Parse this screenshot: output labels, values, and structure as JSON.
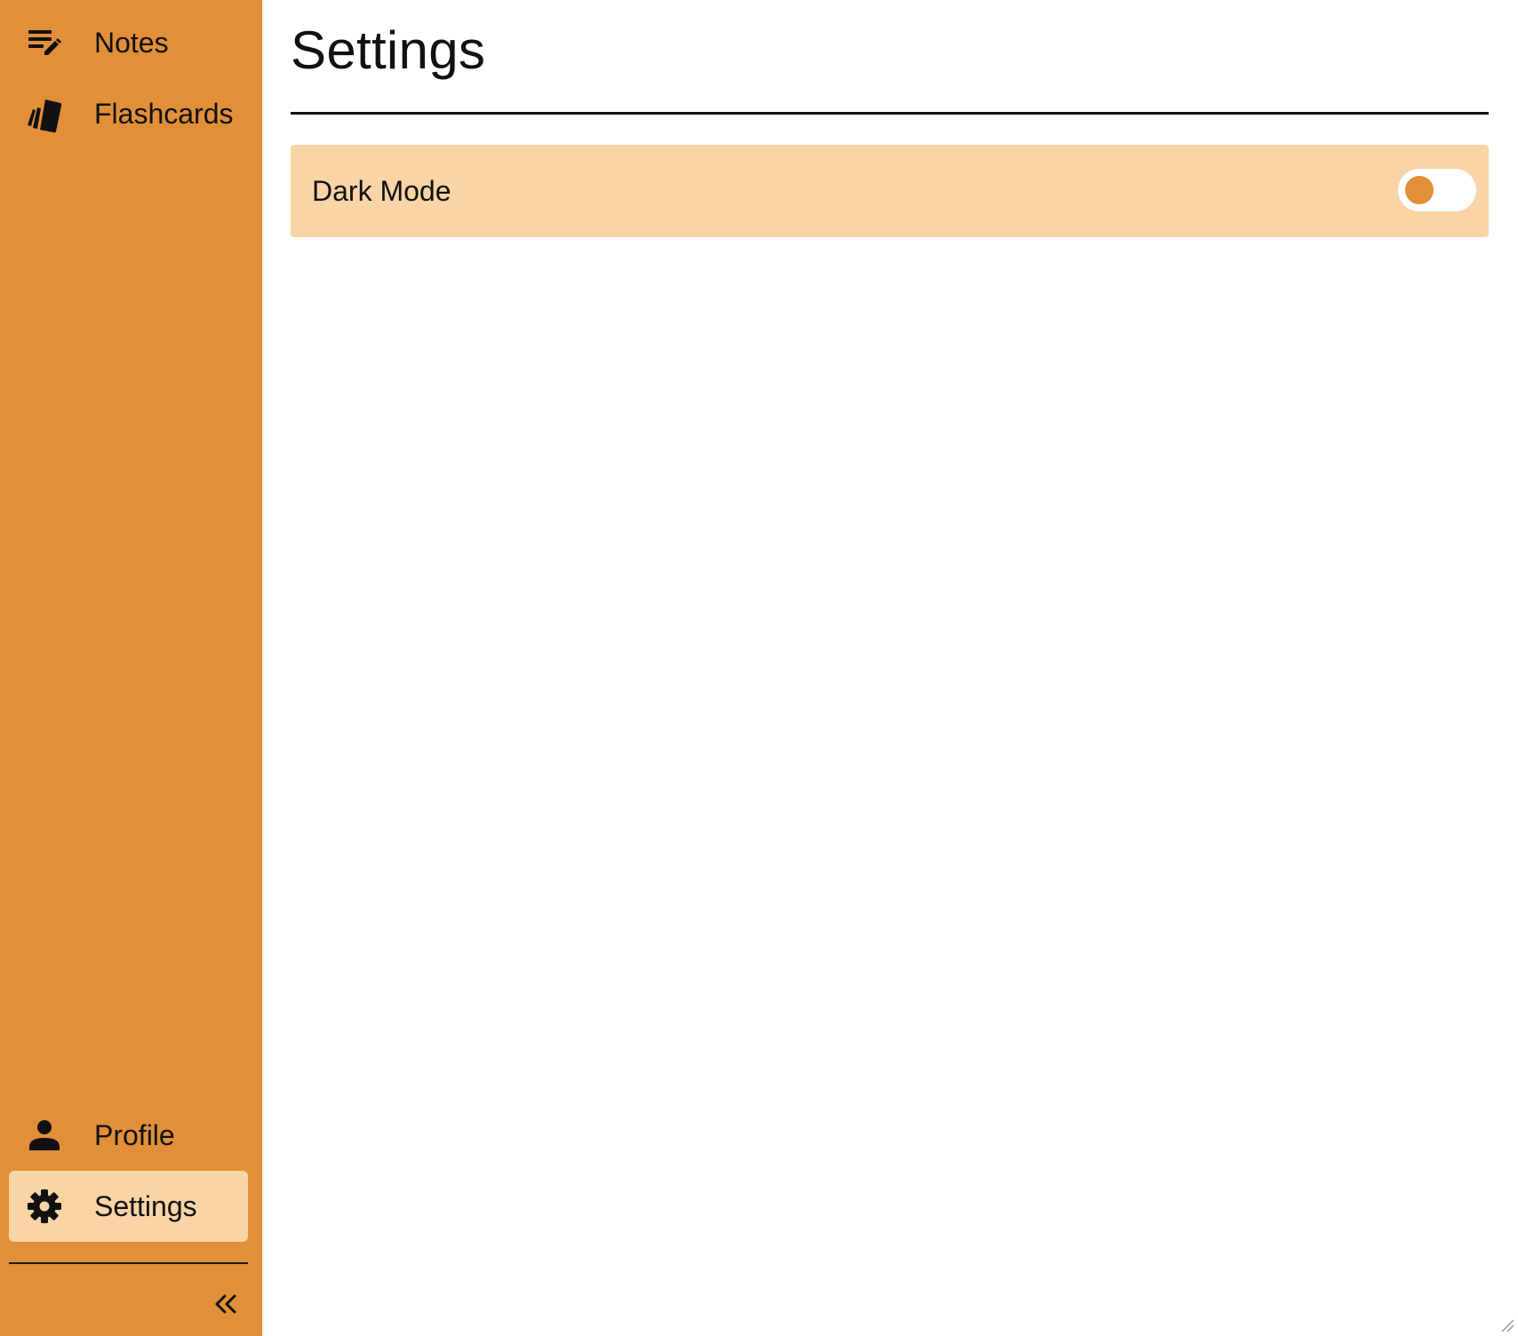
{
  "colors": {
    "sidebar_bg": "#e18f38",
    "active_item_bg": "#f8d4a6",
    "setting_row_bg": "#f8d4a6",
    "toggle_knob": "#e18f38",
    "toggle_track": "#ffffff"
  },
  "sidebar": {
    "top_items": [
      {
        "label": "Notes",
        "icon": "notes-edit-icon"
      },
      {
        "label": "Flashcards",
        "icon": "flashcards-icon"
      }
    ],
    "bottom_items": [
      {
        "label": "Profile",
        "icon": "person-icon"
      },
      {
        "label": "Settings",
        "icon": "gear-icon",
        "active": true
      }
    ],
    "collapse_icon": "double-chevron-left-icon"
  },
  "main": {
    "title": "Settings",
    "settings": [
      {
        "label": "Dark Mode",
        "type": "toggle",
        "enabled": false
      }
    ]
  }
}
